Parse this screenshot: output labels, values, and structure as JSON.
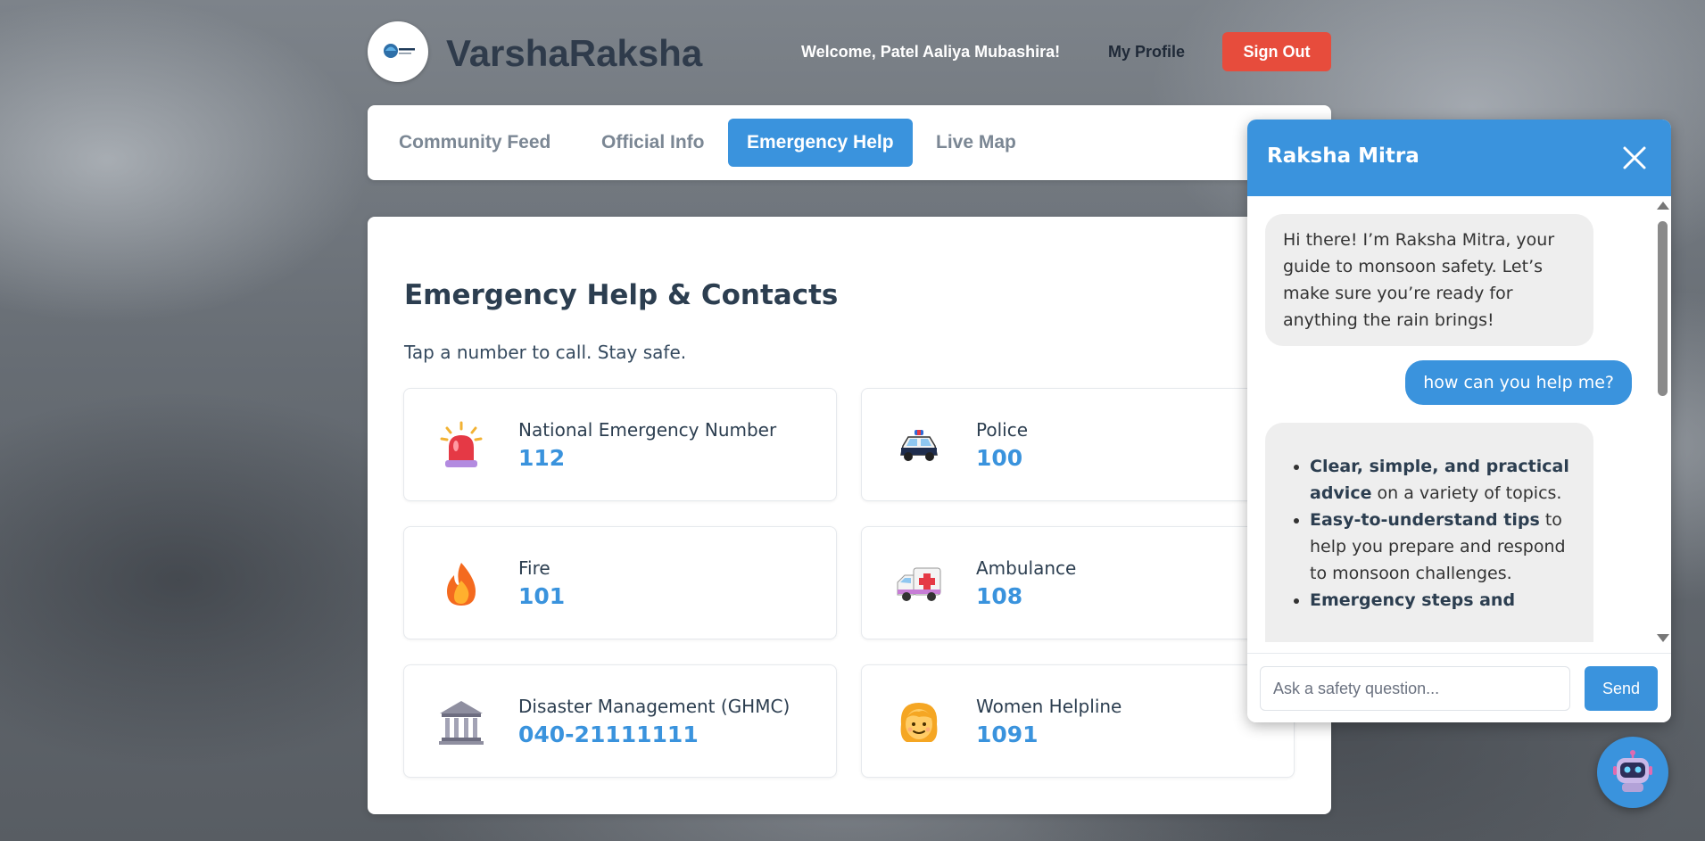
{
  "header": {
    "brand": "VarshaRaksha",
    "welcome": "Welcome, Patel Aaliya Mubashira!",
    "profile": "My Profile",
    "sign_out": "Sign Out"
  },
  "nav": {
    "tabs": [
      {
        "label": "Community Feed",
        "active": false
      },
      {
        "label": "Official Info",
        "active": false
      },
      {
        "label": "Emergency Help",
        "active": true
      },
      {
        "label": "Live Map",
        "active": false
      }
    ]
  },
  "main": {
    "title": "Emergency Help & Contacts",
    "subtitle": "Tap a number to call. Stay safe.",
    "contacts": [
      {
        "name": "National Emergency Number",
        "number": "112",
        "icon": "siren-icon"
      },
      {
        "name": "Police",
        "number": "100",
        "icon": "police-car-icon"
      },
      {
        "name": "Fire",
        "number": "101",
        "icon": "fire-icon"
      },
      {
        "name": "Ambulance",
        "number": "108",
        "icon": "ambulance-icon"
      },
      {
        "name": "Disaster Management (GHMC)",
        "number": "040-21111111",
        "icon": "government-building-icon"
      },
      {
        "name": "Women Helpline",
        "number": "1091",
        "icon": "woman-icon"
      }
    ]
  },
  "chat": {
    "title": "Raksha Mitra",
    "messages": [
      {
        "from": "bot",
        "text": "Hi there! I’m Raksha Mitra, your guide to monsoon safety. Let’s make sure you’re ready for anything the rain brings!"
      },
      {
        "from": "user",
        "text": "how can you help me?"
      },
      {
        "from": "bot",
        "items": [
          {
            "bold": "Clear, simple, and practical advice",
            "rest": " on a variety of topics."
          },
          {
            "bold": "Easy-to-understand tips",
            "rest": " to help you prepare and respond to monsoon challenges."
          },
          {
            "bold": "Emergency steps and",
            "rest": ""
          }
        ]
      }
    ],
    "input_placeholder": "Ask a safety question...",
    "send_label": "Send"
  },
  "colors": {
    "accent": "#3a93dd",
    "danger": "#e74c3c",
    "heading": "#2c3e50"
  }
}
